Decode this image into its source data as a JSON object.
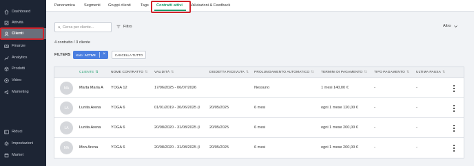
{
  "sidebar": {
    "items": [
      {
        "label": "Dashboard",
        "icon": "home-icon"
      },
      {
        "label": "Attività",
        "icon": "activity-icon"
      },
      {
        "label": "Clienti",
        "icon": "user-icon",
        "active": true
      },
      {
        "label": "Finanze",
        "icon": "finance-icon"
      },
      {
        "label": "Analytics",
        "icon": "chart-icon"
      },
      {
        "label": "Prodotti",
        "icon": "box-icon"
      },
      {
        "label": "Video",
        "icon": "play-icon"
      },
      {
        "label": "Marketing",
        "icon": "megaphone-icon"
      },
      {
        "label": "Riduci",
        "icon": "collapse-icon"
      },
      {
        "label": "Impostazioni",
        "icon": "gear-icon"
      },
      {
        "label": "Market",
        "icon": "store-icon"
      }
    ]
  },
  "tabs": [
    {
      "label": "Panoramica"
    },
    {
      "label": "Segmenti"
    },
    {
      "label": "Gruppi clienti"
    },
    {
      "label": "Tags"
    },
    {
      "label": "Contratti attivi",
      "active": true
    },
    {
      "label": "Valutazioni & Feedback"
    }
  ],
  "search": {
    "placeholder": "Cerca per cliente..."
  },
  "filter_button": "Filtro",
  "altro": "Altro",
  "count_text": "4 contratto / 3 cliente",
  "filters": {
    "label": "FILTERS",
    "chip": {
      "key": "stato:",
      "value": "ACTIVE"
    },
    "clear_label": "CANCELLA TUTTO"
  },
  "table": {
    "columns": [
      "CLIENTE",
      "NOME CONTRATTO",
      "VALIDITÀ",
      "DISDETTA RICEVUTA",
      "PROLUNGAMENTO AUTOMATICO",
      "TERMINI DI PAGAMENTO",
      "TIPO PAGAMENTO",
      "ULTIMA PAUSA"
    ],
    "rows": [
      {
        "initials": "MA",
        "client": "Marta Maria A",
        "contract": "YOGA 12",
        "validity": "17/06/2025 - 06/07/2026",
        "cancellation": "",
        "auto_renewal": "Nessuno",
        "payment_terms": "1 mesi 140,00 €",
        "payment_type": "-",
        "last_pause": "-"
      },
      {
        "initials": "LA",
        "client": "Lunita Arena",
        "contract": "YOGA 6",
        "validity": "01/01/2019 - 30/06/2025 (I",
        "cancellation": "20/05/2025",
        "auto_renewal": "6 mesi",
        "payment_terms": "ogni 1 mese 120,00 €",
        "payment_type": "-",
        "last_pause": "-"
      },
      {
        "initials": "LA",
        "client": "Lunita Arena",
        "contract": "YOGA 6",
        "validity": "20/08/2020 - 31/08/2025 (I",
        "cancellation": "20/05/2025",
        "auto_renewal": "6 mesi",
        "payment_terms": "ogni 1 mese 200,00 €",
        "payment_type": "-",
        "last_pause": "-"
      },
      {
        "initials": "MA",
        "client": "Mon Arena",
        "contract": "YOGA 6",
        "validity": "20/08/2020 - 31/08/2025 (I",
        "cancellation": "20/05/2025",
        "auto_renewal": "6 mesi",
        "payment_terms": "ogni 1 mese 200,00 €",
        "payment_type": "-",
        "last_pause": "-"
      }
    ]
  },
  "colors": {
    "sidebar_bg": "#1d2534",
    "accent_green": "#1a9c6a",
    "highlight_red": "#d2222a",
    "chip_blue": "#4a7ee0"
  }
}
